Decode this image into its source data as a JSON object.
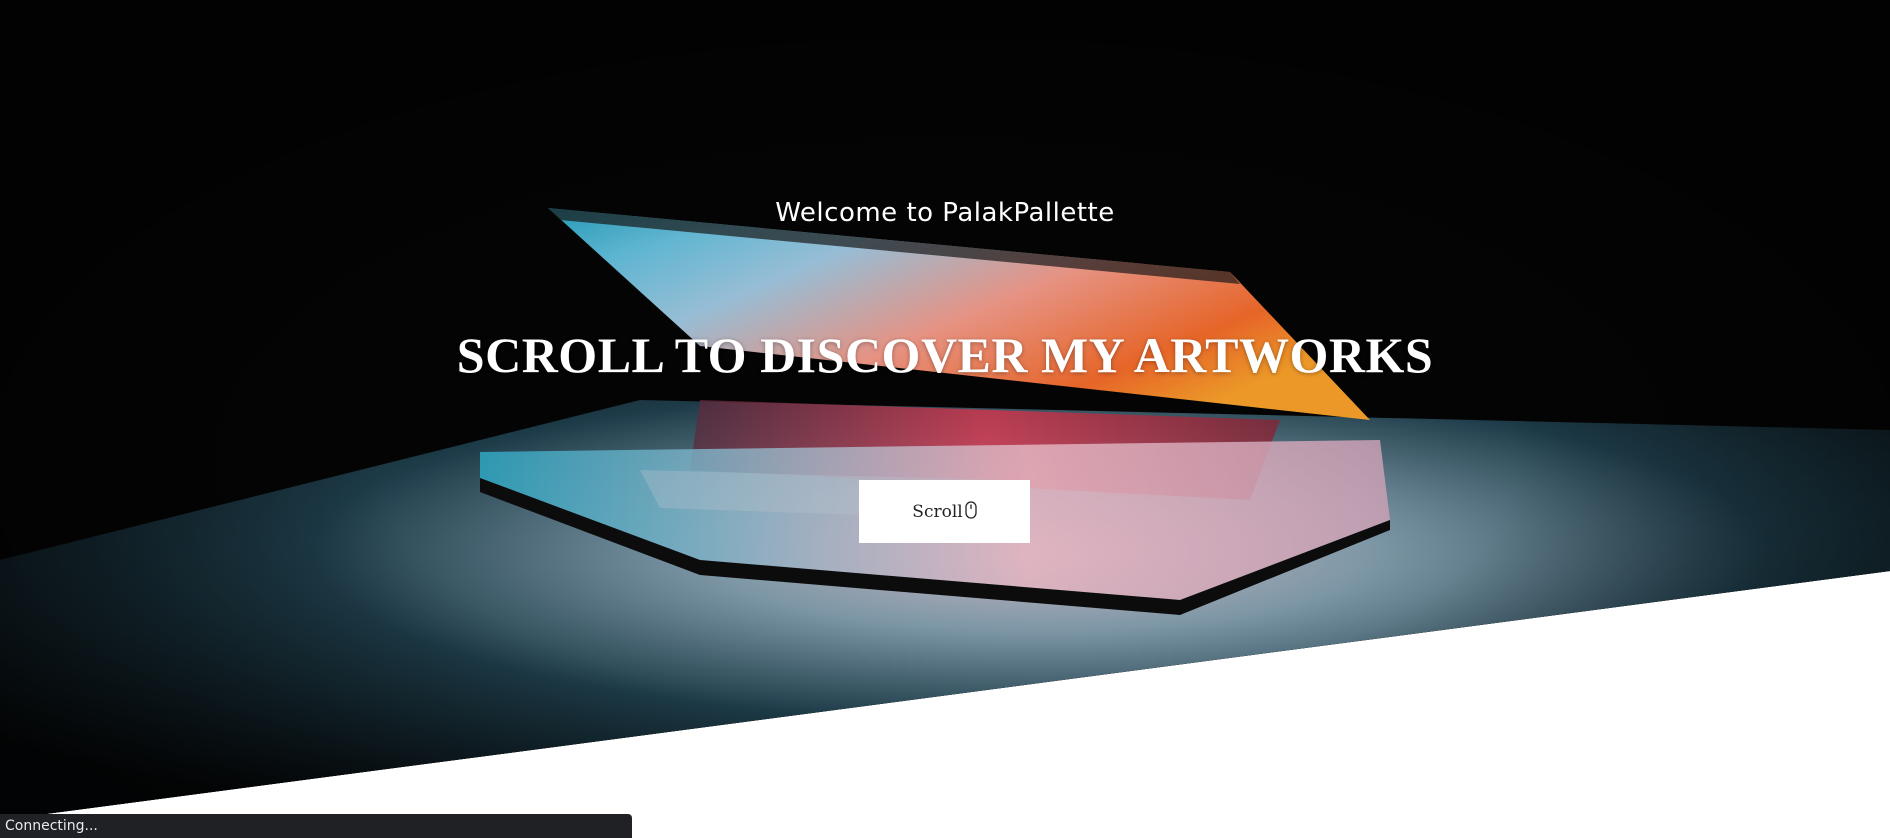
{
  "hero": {
    "welcome_text": "Welcome to PalakPallette",
    "headline": "SCROLL TO DISCOVER MY ARTWORKS",
    "scroll_button": {
      "label": "Scroll",
      "icon": "mouse-icon"
    },
    "background_image": "laptop-glowing-screen"
  },
  "browser_status": {
    "text": "Connecting..."
  },
  "colors": {
    "background": "#ffffff",
    "hero_dark": "#030303",
    "text_light": "#ffffff",
    "button_bg": "#ffffff",
    "status_bar_bg": "#202124"
  }
}
